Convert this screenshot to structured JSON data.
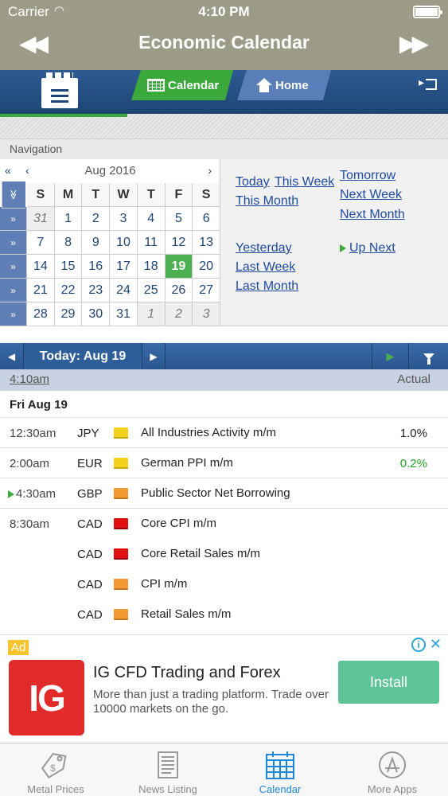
{
  "status_bar": {
    "carrier": "Carrier",
    "time": "4:10 PM"
  },
  "nav_bar": {
    "title": "Economic Calendar"
  },
  "header": {
    "tab_calendar": "Calendar",
    "tab_home": "Home"
  },
  "navigation": {
    "label": "Navigation",
    "month_label": "Aug 2016",
    "weekdays": [
      "S",
      "M",
      "T",
      "W",
      "T",
      "F",
      "S"
    ],
    "weeks": [
      [
        "31",
        "1",
        "2",
        "3",
        "4",
        "5",
        "6"
      ],
      [
        "7",
        "8",
        "9",
        "10",
        "11",
        "12",
        "13"
      ],
      [
        "14",
        "15",
        "16",
        "17",
        "18",
        "19",
        "20"
      ],
      [
        "21",
        "22",
        "23",
        "24",
        "25",
        "26",
        "27"
      ],
      [
        "28",
        "29",
        "30",
        "31",
        "1",
        "2",
        "3"
      ]
    ],
    "selected_day": "19",
    "quick_links": {
      "today": "Today",
      "this_week": "This Week",
      "tomorrow": "Tomorrow",
      "this_month": "This Month",
      "next_week": "Next Week",
      "next_month": "Next Month",
      "yesterday": "Yesterday",
      "up_next": "Up Next",
      "last_week": "Last Week",
      "last_month": "Last Month"
    }
  },
  "date_bar": {
    "label": "Today: Aug 19"
  },
  "time_bar": {
    "time": "4:10am",
    "actual_header": "Actual"
  },
  "day_header": "Fri Aug 19",
  "events": [
    {
      "time": "12:30am",
      "currency": "JPY",
      "impact": "low",
      "name": "All Industries Activity m/m",
      "actual": "1.0%",
      "actual_color": "#222222"
    },
    {
      "time": "2:00am",
      "currency": "EUR",
      "impact": "low",
      "name": "German PPI m/m",
      "actual": "0.2%",
      "actual_color": "#22a722"
    },
    {
      "time": "4:30am",
      "currency": "GBP",
      "impact": "med",
      "name": "Public Sector Net Borrowing",
      "actual": ""
    },
    {
      "time": "8:30am",
      "currency": "CAD",
      "impact": "high",
      "name": "Core CPI m/m",
      "actual": ""
    },
    {
      "time": "",
      "currency": "CAD",
      "impact": "high",
      "name": "Core Retail Sales m/m",
      "actual": ""
    },
    {
      "time": "",
      "currency": "CAD",
      "impact": "med",
      "name": "CPI m/m",
      "actual": ""
    },
    {
      "time": "",
      "currency": "CAD",
      "impact": "med",
      "name": "Retail Sales m/m",
      "actual": ""
    }
  ],
  "ad": {
    "badge": "Ad",
    "logo_text": "IG",
    "title": "IG CFD Trading and Forex",
    "description": "More than just a trading platform. Trade over 10000 markets on the go.",
    "install_label": "Install"
  },
  "tab_bar": {
    "metal_prices": "Metal Prices",
    "news_listing": "News Listing",
    "calendar": "Calendar",
    "more_apps": "More Apps"
  },
  "colors": {
    "nav_bar": "#9b9b87",
    "header_blue": "#1e4474",
    "accent_green": "#3ca93c",
    "link_blue": "#1e4aa0",
    "tab_active": "#1e88d8"
  }
}
